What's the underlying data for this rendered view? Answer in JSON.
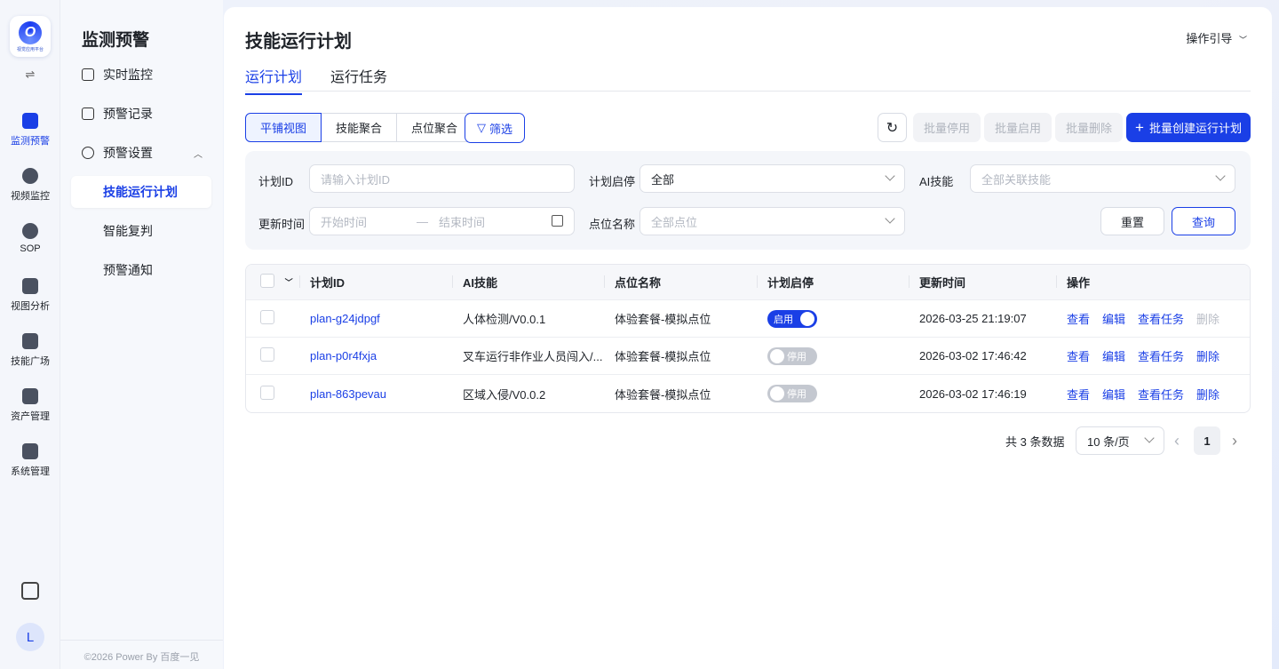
{
  "rail": {
    "logo_text": "视觉应用平台",
    "toggle": "⇌",
    "items": [
      {
        "label": "监测预警",
        "icon": "chart-icon",
        "active": true
      },
      {
        "label": "视频监控",
        "icon": "camera-icon"
      },
      {
        "label": "SOP",
        "icon": "sop-icon"
      },
      {
        "label": "视图分析",
        "icon": "image-search-icon"
      },
      {
        "label": "技能广场",
        "icon": "skills-icon"
      },
      {
        "label": "资产管理",
        "icon": "asset-icon"
      },
      {
        "label": "系统管理",
        "icon": "settings-icon"
      }
    ],
    "avatar": "L"
  },
  "sidebar": {
    "title": "监测预警",
    "items": [
      {
        "label": "实时监控",
        "icon": "monitor-icon"
      },
      {
        "label": "预警记录",
        "icon": "alarm-icon"
      },
      {
        "label": "预警设置",
        "icon": "gear-icon"
      },
      {
        "label": "技能运行计划"
      },
      {
        "label": "智能复判"
      },
      {
        "label": "预警通知"
      }
    ],
    "footer": "©2026 Power By 百度一见"
  },
  "header": {
    "title": "技能运行计划",
    "guide": "操作引导"
  },
  "tabs": [
    "运行计划",
    "运行任务"
  ],
  "toolbar": {
    "views": [
      "平铺视图",
      "技能聚合",
      "点位聚合"
    ],
    "filter": "筛选",
    "refresh_icon": "↻",
    "batch_stop": "批量停用",
    "batch_start": "批量启用",
    "batch_delete": "批量删除",
    "batch_create": "批量创建运行计划"
  },
  "query": {
    "plan_id_label": "计划ID",
    "plan_id_placeholder": "请输入计划ID",
    "status_label": "计划启停",
    "status_value": "全部",
    "skill_label": "AI技能",
    "skill_placeholder": "全部关联技能",
    "time_label": "更新时间",
    "start_placeholder": "开始时间",
    "range_sep": "—",
    "end_placeholder": "结束时间",
    "point_label": "点位名称",
    "point_placeholder": "全部点位",
    "reset": "重置",
    "search": "查询"
  },
  "table": {
    "columns": [
      "计划ID",
      "AI技能",
      "点位名称",
      "计划启停",
      "更新时间",
      "操作"
    ],
    "rows": [
      {
        "id": "plan-g24jdpgf",
        "skill": "人体检测/V0.0.1",
        "point": "体验套餐-模拟点位",
        "status": "启用",
        "on": true,
        "time": "2026-03-25 21:19:07",
        "ops": [
          "查看",
          "编辑",
          "查看任务",
          "删除"
        ],
        "delete_enabled": false
      },
      {
        "id": "plan-p0r4fxja",
        "skill": "叉车运行非作业人员闯入/...",
        "point": "体验套餐-模拟点位",
        "status": "停用",
        "on": false,
        "time": "2026-03-02 17:46:42",
        "ops": [
          "查看",
          "编辑",
          "查看任务",
          "删除"
        ],
        "delete_enabled": true
      },
      {
        "id": "plan-863pevau",
        "skill": "区域入侵/V0.0.2",
        "point": "体验套餐-模拟点位",
        "status": "停用",
        "on": false,
        "time": "2026-03-02 17:46:19",
        "ops": [
          "查看",
          "编辑",
          "查看任务",
          "删除"
        ],
        "delete_enabled": true
      }
    ]
  },
  "pagination": {
    "total": "共 3 条数据",
    "page_size": "10 条/页",
    "current": "1",
    "prev": "‹",
    "next": "›"
  },
  "colors": {
    "accent": "#1a3fe6"
  }
}
